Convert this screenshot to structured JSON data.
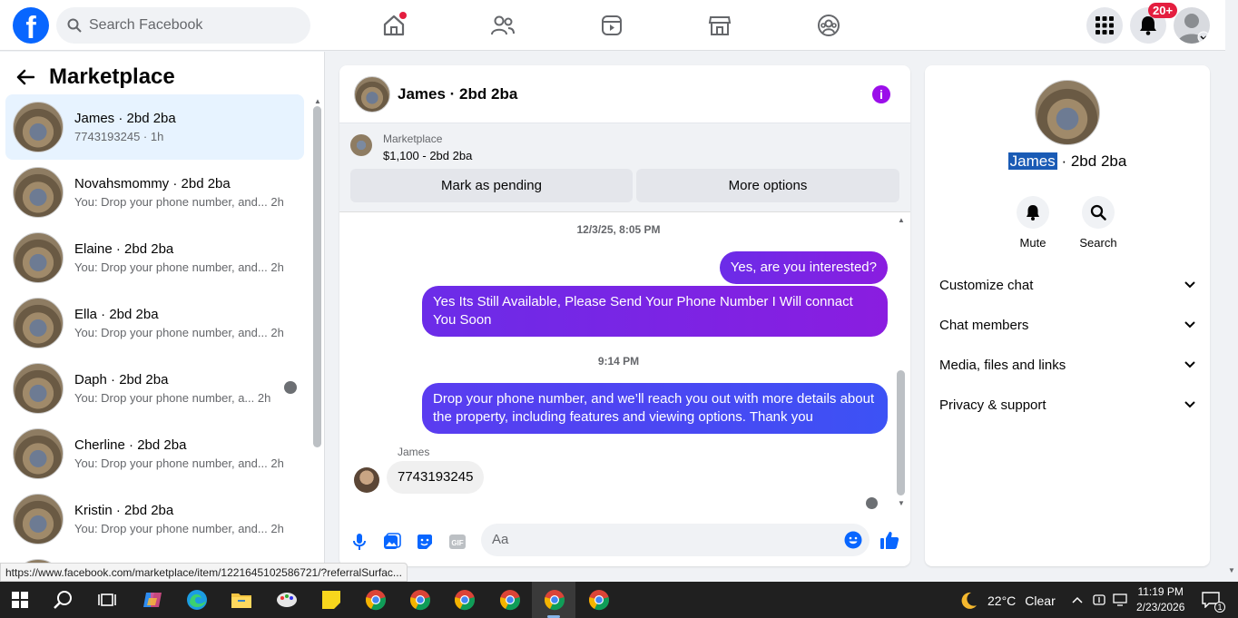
{
  "topbar": {
    "logo_letter": "f",
    "search_placeholder": "Search Facebook",
    "notifications_badge": "20+"
  },
  "left_panel": {
    "title": "Marketplace",
    "conversations": [
      {
        "name": "James · 2bd 2ba",
        "sub": "7743193245 · 1h",
        "time": "",
        "active": true
      },
      {
        "name": "Novahsmommy · 2bd 2ba",
        "sub": "You: Drop your phone number, and...",
        "time": "2h"
      },
      {
        "name": "Elaine · 2bd 2ba",
        "sub": "You: Drop your phone number, and...",
        "time": "2h"
      },
      {
        "name": "Ella · 2bd 2ba",
        "sub": "You: Drop your phone number, and...",
        "time": "2h"
      },
      {
        "name": "Daph · 2bd 2ba",
        "sub": "You: Drop your phone number, a...",
        "time": "2h"
      },
      {
        "name": "Cherline · 2bd 2ba",
        "sub": "You: Drop your phone number, and...",
        "time": "2h"
      },
      {
        "name": "Kristin · 2bd 2ba",
        "sub": "You: Drop your phone number, and...",
        "time": "2h"
      }
    ]
  },
  "chat": {
    "title": "James · 2bd 2ba",
    "marketplace_label": "Marketplace",
    "listing": "$1,100 - 2bd 2ba",
    "mark_pending": "Mark as pending",
    "more_options": "More options",
    "timestamp1": "12/3/25, 8:05 PM",
    "msg1": "Yes, are you interested?",
    "msg2": "Yes Its Still Available, Please Send Your Phone Number I Will connact You Soon",
    "timestamp2": "9:14 PM",
    "msg3": "Drop your phone number, and we’ll reach you out with more details about the property, including features and viewing options.  Thank you",
    "sender": "James",
    "msg4": "7743193245",
    "input_placeholder": "Aa",
    "gif_label": "GIF"
  },
  "right_panel": {
    "name_first": "James",
    "name_rest": " · 2bd 2ba",
    "mute": "Mute",
    "search": "Search",
    "sections": [
      "Customize chat",
      "Chat members",
      "Media, files and links",
      "Privacy & support"
    ]
  },
  "status_link": "https://www.facebook.com/marketplace/item/1221645102586721/?referralSurfac...",
  "taskbar": {
    "temperature": "22°C",
    "condition": "Clear",
    "time": "11:19 PM",
    "date": "2/23/2026",
    "notification_count": "1"
  },
  "colors": {
    "fb_blue": "#0866ff",
    "bubble_purple": "#7a24e6",
    "bubble_blue": "#4a47f2",
    "active_row": "#e7f3ff"
  }
}
